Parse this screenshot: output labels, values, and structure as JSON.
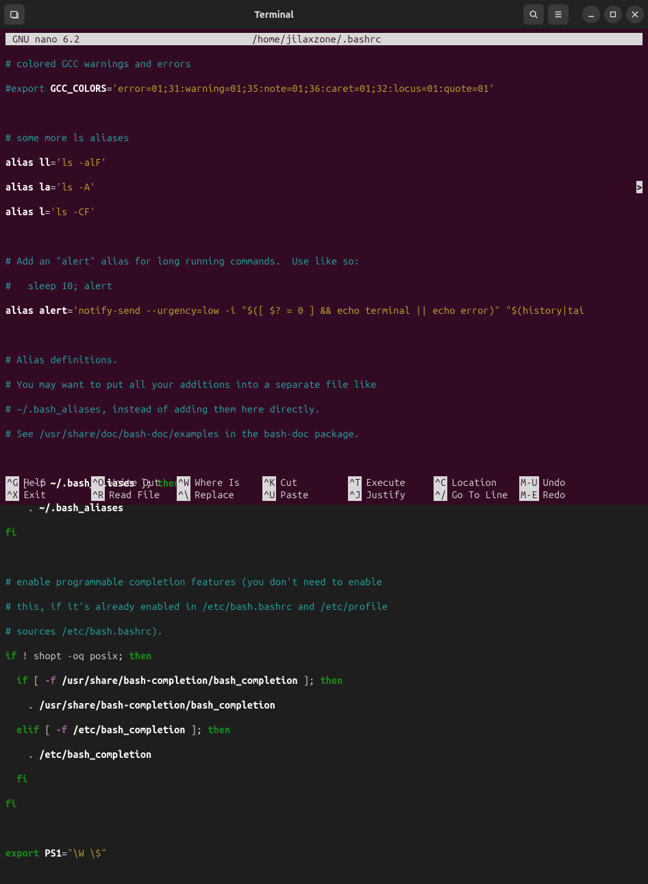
{
  "titlebar": {
    "title": "Terminal"
  },
  "nano": {
    "version": " GNU nano 6.2",
    "filepath": "/home/jilaxzone/.bashrc"
  },
  "lines": {
    "l1": {
      "a": "# colored GCC warnings and errors"
    },
    "l2": {
      "a": "#export",
      "b": " GCC_COLORS",
      "c": "=",
      "d": "'error=01;31:warning=01;35:note=01;36:caret=01;32:locus=01:quote=01'"
    },
    "l3": {
      "a": ""
    },
    "l4": {
      "a": "# some more ls aliases"
    },
    "l5": {
      "a": "alias",
      "b": " ll",
      "c": "=",
      "d": "'ls -alF'"
    },
    "l6": {
      "a": "alias",
      "b": " la",
      "c": "=",
      "d": "'ls -A'"
    },
    "l7": {
      "a": "alias",
      "b": " l",
      "c": "=",
      "d": "'ls -CF'"
    },
    "l8": {
      "a": ""
    },
    "l9": {
      "a": "# Add an ",
      "b": "\"alert\"",
      "c": " alias for long running commands.  Use like so:"
    },
    "l10": {
      "a": "#   sleep 10; alert"
    },
    "l11": {
      "a": "alias",
      "b": " alert",
      "c": "=",
      "d": "'notify-send --urgency=low -i \"$([ $? = 0 ] && echo terminal || echo error)\" \"$(history|tai"
    },
    "l12": {
      "a": ""
    },
    "l13": {
      "a": "# Alias definitions."
    },
    "l14": {
      "a": "# You may want to put all your additions into a separate file like"
    },
    "l15": {
      "a": "# ~/.bash_aliases, instead of adding them here directly."
    },
    "l16": {
      "a": "# See /usr/share/doc/bash-doc/examples in the bash-doc package."
    },
    "l17": {
      "a": ""
    },
    "l18": {
      "a": "if",
      "b": " [",
      "c": " -f",
      "d": " ~/.bash_aliases",
      "e": " ];",
      "f": " then"
    },
    "l19": {
      "a": "    .",
      "b": " ~/.bash_aliases"
    },
    "l20": {
      "a": "fi"
    },
    "l21": {
      "a": ""
    },
    "l22": {
      "a": "# enable programmable completion features (you don't need to enable"
    },
    "l23": {
      "a": "# this, if it's already enabled in /etc/bash.bashrc and /etc/profile"
    },
    "l24": {
      "a": "# sources /etc/bash.bashrc)."
    },
    "l25": {
      "a": "if",
      "b": " ! shopt -oq posix;",
      "c": " then"
    },
    "l26": {
      "a": "  if",
      "b": " [",
      "c": " -f",
      "d": " /usr/share/bash-completion/bash_completion",
      "e": " ];",
      "f": " then"
    },
    "l27": {
      "a": "    .",
      "b": " /usr/share/bash-completion/bash_completion"
    },
    "l28": {
      "a": "  elif",
      "b": " [",
      "c": " -f",
      "d": " /etc/bash_completion",
      "e": " ];",
      "f": " then"
    },
    "l29": {
      "a": "    .",
      "b": " /etc/bash_completion"
    },
    "l30": {
      "a": "  fi"
    },
    "l31": {
      "a": "fi"
    },
    "l32": {
      "a": ""
    },
    "l33": {
      "a": "export",
      "b": " PS1",
      "c": "=",
      "d": "\"\\W \\$\""
    }
  },
  "overflow_mark": ">",
  "shortcuts": {
    "row1": [
      {
        "key": "^G",
        "label": "Help"
      },
      {
        "key": "^O",
        "label": "Write Out"
      },
      {
        "key": "^W",
        "label": "Where Is"
      },
      {
        "key": "^K",
        "label": "Cut"
      },
      {
        "key": "^T",
        "label": "Execute"
      },
      {
        "key": "^C",
        "label": "Location"
      },
      {
        "key": "M-U",
        "label": "Undo"
      }
    ],
    "row2": [
      {
        "key": "^X",
        "label": "Exit"
      },
      {
        "key": "^R",
        "label": "Read File"
      },
      {
        "key": "^\\",
        "label": "Replace"
      },
      {
        "key": "^U",
        "label": "Paste"
      },
      {
        "key": "^J",
        "label": "Justify"
      },
      {
        "key": "^/",
        "label": "Go To Line"
      },
      {
        "key": "M-E",
        "label": "Redo"
      }
    ]
  }
}
